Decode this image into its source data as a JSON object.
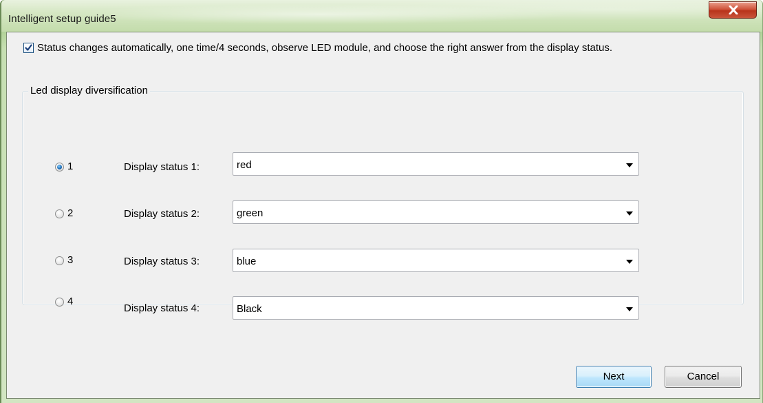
{
  "window": {
    "title": "Intelligent setup guide5",
    "close_symbol": "x"
  },
  "auto_status": {
    "checked": true,
    "label": "Status changes automatically, one time/4 seconds, observe LED module, and choose the right answer from the display status."
  },
  "group": {
    "title": "Led display diversification",
    "rows": [
      {
        "radio_label": "1",
        "selected": true,
        "field_label": "Display status 1:",
        "value": "red"
      },
      {
        "radio_label": "2",
        "selected": false,
        "field_label": "Display status 2:",
        "value": "green"
      },
      {
        "radio_label": "3",
        "selected": false,
        "field_label": "Display status 3:",
        "value": "blue"
      },
      {
        "radio_label": "4",
        "selected": false,
        "field_label": "Display status 4:",
        "value": "Black"
      }
    ]
  },
  "buttons": {
    "next": "Next",
    "cancel": "Cancel"
  },
  "colors": {
    "title_frame": "#c3dcab",
    "close_button": "#c9543a",
    "client_bg": "#f0f0f0",
    "default_button_border": "#3c7fb1"
  }
}
